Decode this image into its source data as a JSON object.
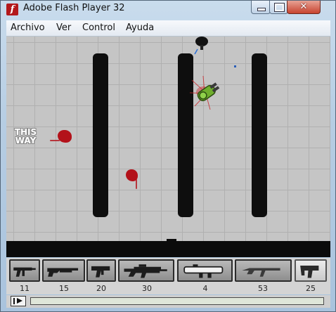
{
  "window": {
    "title": "Adobe Flash Player 32",
    "icon": "flash-player-icon",
    "close_glyph": "✕"
  },
  "menu": {
    "items": [
      "Archivo",
      "Ver",
      "Control",
      "Ayuda"
    ]
  },
  "game": {
    "sign_text_line1": "THIS",
    "sign_text_line2": "WAY",
    "colors": {
      "floor": "#c5c5c5",
      "grid": "#b0b0b0",
      "walls": "#0e0e0e",
      "blood": "#b3121a",
      "player": "#7bbf3a"
    }
  },
  "weapons": [
    {
      "name": "submachine-gun",
      "ammo": "11",
      "selected": false
    },
    {
      "name": "shotgun",
      "ammo": "15",
      "selected": false
    },
    {
      "name": "machine-pistol",
      "ammo": "20",
      "selected": false
    },
    {
      "name": "assault-rifle",
      "ammo": "30",
      "selected": false
    },
    {
      "name": "rocket-launcher",
      "ammo": "4",
      "selected": false
    },
    {
      "name": "ak-rifle",
      "ammo": "53",
      "selected": false
    },
    {
      "name": "uzi",
      "ammo": "25",
      "selected": true
    }
  ],
  "controls": {
    "play_icon": "play-step-icon",
    "progress_fraction": 0.0
  }
}
